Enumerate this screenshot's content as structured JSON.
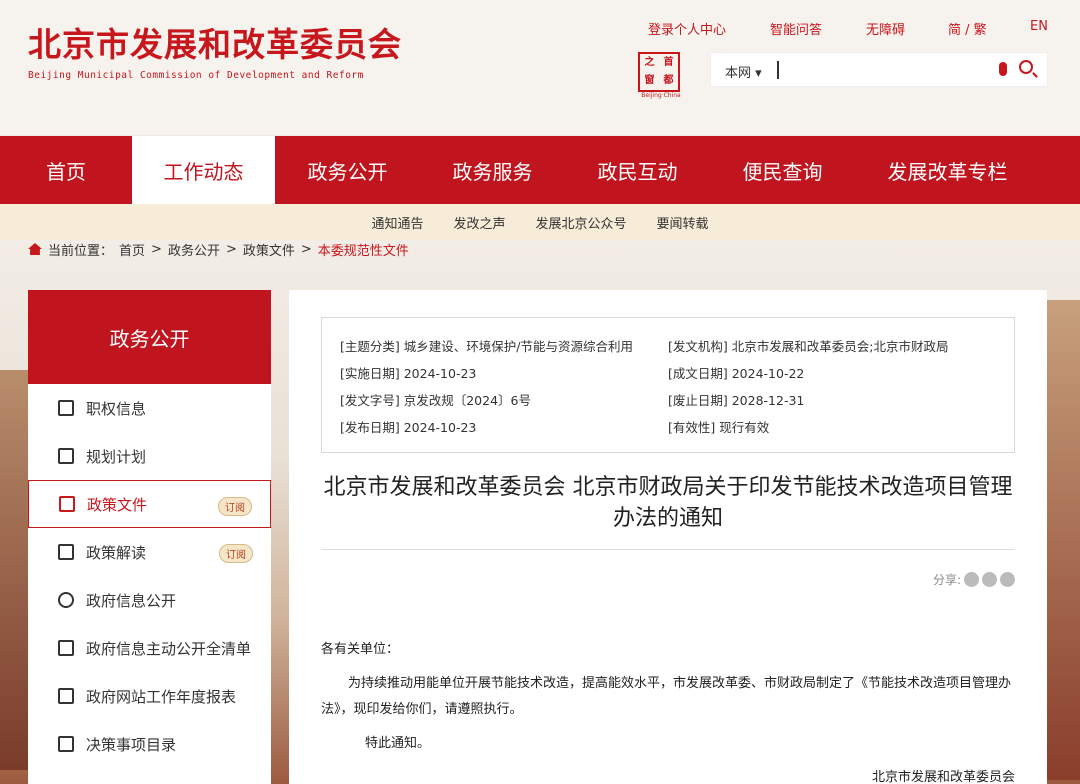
{
  "header": {
    "title_cn": "北京市发展和改革委员会",
    "title_en": "Beijing Municipal Commission of Development and Reform",
    "links": [
      "登录个人中心",
      "智能问答",
      "无障碍",
      "简 / 繁",
      "EN"
    ],
    "seal": {
      "chars": [
        "之",
        "首",
        "窗",
        "都"
      ],
      "caption": "Beijing·China"
    },
    "search": {
      "scope": "本网 ▾"
    }
  },
  "nav": {
    "items": [
      "首页",
      "工作动态",
      "政务公开",
      "政务服务",
      "政民互动",
      "便民查询",
      "发展改革专栏"
    ],
    "active": "工作动态"
  },
  "subnav": {
    "items": [
      "通知通告",
      "发改之声",
      "发展北京公众号",
      "要闻转载"
    ]
  },
  "breadcrumb": {
    "label": "当前位置：",
    "items": [
      "首页",
      "政务公开",
      "政策文件",
      "本委规范性文件"
    ]
  },
  "sidebar": {
    "title": "政务公开",
    "items": [
      {
        "label": "职权信息",
        "icon": "person-icon"
      },
      {
        "label": "规划计划",
        "icon": "edit-icon"
      },
      {
        "label": "政策文件",
        "icon": "layers-icon",
        "badge": "订阅",
        "active": true
      },
      {
        "label": "政策解读",
        "icon": "reading-icon",
        "badge": "订阅"
      },
      {
        "label": "政府信息公开",
        "icon": "compass-icon"
      },
      {
        "label": "政府信息主动公开全清单",
        "icon": "document-icon"
      },
      {
        "label": "政府网站工作年度报表",
        "icon": "report-icon"
      },
      {
        "label": "决策事项目录",
        "icon": "calendar-icon"
      }
    ]
  },
  "meta": {
    "topic": "[主题分类] 城乡建设、环境保护/节能与资源综合利用",
    "org": "[发文机构] 北京市发展和改革委员会;北京市财政局",
    "impl": "[实施日期] 2024-10-23",
    "made": "[成文日期] 2024-10-22",
    "docno": "[发文字号] 京发改规〔2024〕6号",
    "expire": "[废止日期] 2028-12-31",
    "pub": "[发布日期] 2024-10-23",
    "valid": "[有效性] 现行有效"
  },
  "article": {
    "title": "北京市发展和改革委员会 北京市财政局关于印发节能技术改造项目管理办法的通知",
    "share_label": "分享:",
    "salutation": "各有关单位：",
    "para1": "为持续推动用能单位开展节能技术改造，提高能效水平，市发展改革委、市财政局制定了《节能技术改造项目管理办法》，现印发给你们，请遵照执行。",
    "notice": "特此通知。",
    "signature": "北京市发展和改革委员会"
  }
}
